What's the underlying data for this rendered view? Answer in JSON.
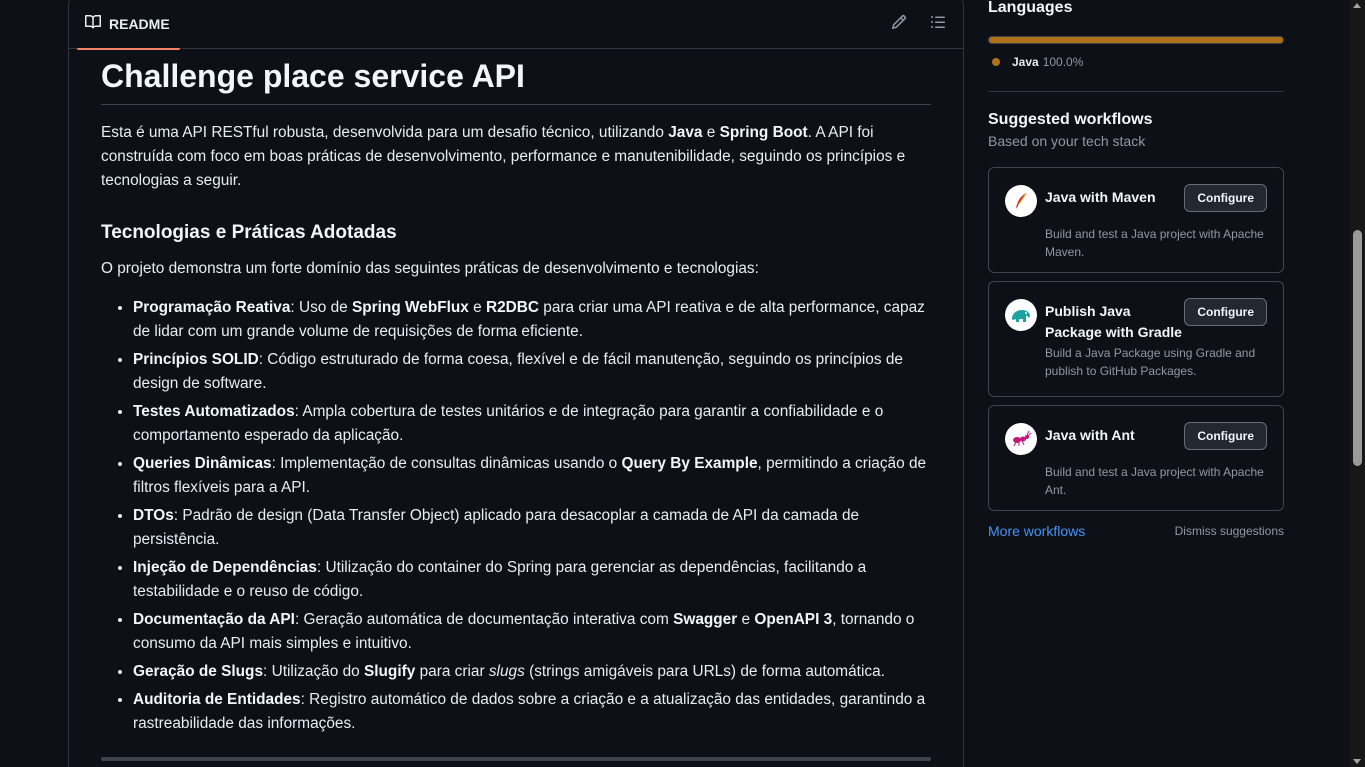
{
  "readme": {
    "tab_label": "README",
    "title": "Challenge place service API",
    "intro": {
      "p1": "Esta é uma API RESTful robusta, desenvolvida para um desafio técnico, utilizando ",
      "b1": "Java",
      "p2": " e ",
      "b2": "Spring Boot",
      "p3": ". A API foi construída com foco em boas práticas de desenvolvimento, performance e manutenibilidade, seguindo os princípios e tecnologias a seguir."
    },
    "section_title": "Tecnologias e Práticas Adotadas",
    "section_intro": "O projeto demonstra um forte domínio das seguintes práticas de desenvolvimento e tecnologias:",
    "items": [
      {
        "b": "Programação Reativa",
        "t1": ": Uso de ",
        "b2": "Spring WebFlux",
        "t2": " e ",
        "b3": "R2DBC",
        "t3": " para criar uma API reativa e de alta performance, capaz de lidar com um grande volume de requisições de forma eficiente."
      },
      {
        "b": "Princípios SOLID",
        "t1": ": Código estruturado de forma coesa, flexível e de fácil manutenção, seguindo os princípios de design de software."
      },
      {
        "b": "Testes Automatizados",
        "t1": ": Ampla cobertura de testes unitários e de integração para garantir a confiabilidade e o comportamento esperado da aplicação."
      },
      {
        "b": "Queries Dinâmicas",
        "t1": ": Implementação de consultas dinâmicas usando o ",
        "b2": "Query By Example",
        "t2": ", permitindo a criação de filtros flexíveis para a API."
      },
      {
        "b": "DTOs",
        "t1": ": Padrão de design (Data Transfer Object) aplicado para desacoplar a camada de API da camada de persistência."
      },
      {
        "b": "Injeção de Dependências",
        "t1": ": Utilização do container do Spring para gerenciar as dependências, facilitando a testabilidade e o reuso de código."
      },
      {
        "b": "Documentação da API",
        "t1": ": Geração automática de documentação interativa com ",
        "b2": "Swagger",
        "t2": " e ",
        "b3": "OpenAPI 3",
        "t3": ", tornando o consumo da API mais simples e intuitivo."
      },
      {
        "b": "Geração de Slugs",
        "t1": ": Utilização do ",
        "b2": "Slugify",
        "t2": " para criar ",
        "i": "slugs",
        "t3": " (strings amigáveis para URLs) de forma automática."
      },
      {
        "b": "Auditoria de Entidades",
        "t1": ": Registro automático de dados sobre a criação e a atualização das entidades, garantindo a rastreabilidade das informações."
      }
    ]
  },
  "sidebar": {
    "languages_title": "Languages",
    "language": {
      "name": "Java",
      "percent": "100.0%",
      "color": "#b07219",
      "share": 1.0
    },
    "workflows_title": "Suggested workflows",
    "workflows_subtitle": "Based on your tech stack",
    "configure_label": "Configure",
    "workflows": [
      {
        "name": "Java with Maven",
        "description": "Build and test a Java project with Apache Maven.",
        "icon": "maven-feather-icon"
      },
      {
        "name": "Publish Java Package with Gradle",
        "description": "Build a Java Package using Gradle and publish to GitHub Packages.",
        "icon": "gradle-elephant-icon"
      },
      {
        "name": "Java with Ant",
        "description": "Build and test a Java project with Apache Ant.",
        "icon": "ant-icon"
      }
    ],
    "more_workflows": "More workflows",
    "dismiss": "Dismiss suggestions"
  },
  "colors": {
    "accent_link": "#4493f8",
    "tab_underline": "#f78166",
    "java": "#b07219"
  }
}
